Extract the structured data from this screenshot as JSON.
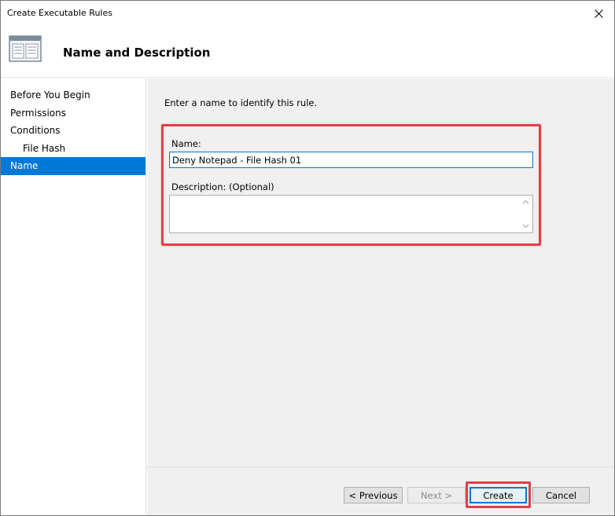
{
  "window": {
    "title": "Create Executable Rules"
  },
  "header": {
    "icon": "wizard-page-icon",
    "title": "Name and Description"
  },
  "sidebar": {
    "items": [
      {
        "label": "Before You Begin"
      },
      {
        "label": "Permissions"
      },
      {
        "label": "Conditions"
      },
      {
        "label": "File Hash"
      },
      {
        "label": "Name"
      }
    ],
    "active_index": 4
  },
  "content": {
    "instruction": "Enter a name to identify this rule.",
    "name_label": "Name:",
    "name_value": "Deny Notepad - File Hash 01",
    "description_label": "Description: (Optional)",
    "description_value": ""
  },
  "footer": {
    "previous_label": "< Previous",
    "next_label": "Next >",
    "create_label": "Create",
    "cancel_label": "Cancel"
  },
  "colors": {
    "accent": "#0078d7",
    "highlight": "#e0404a",
    "panel": "#f0f0f0"
  }
}
